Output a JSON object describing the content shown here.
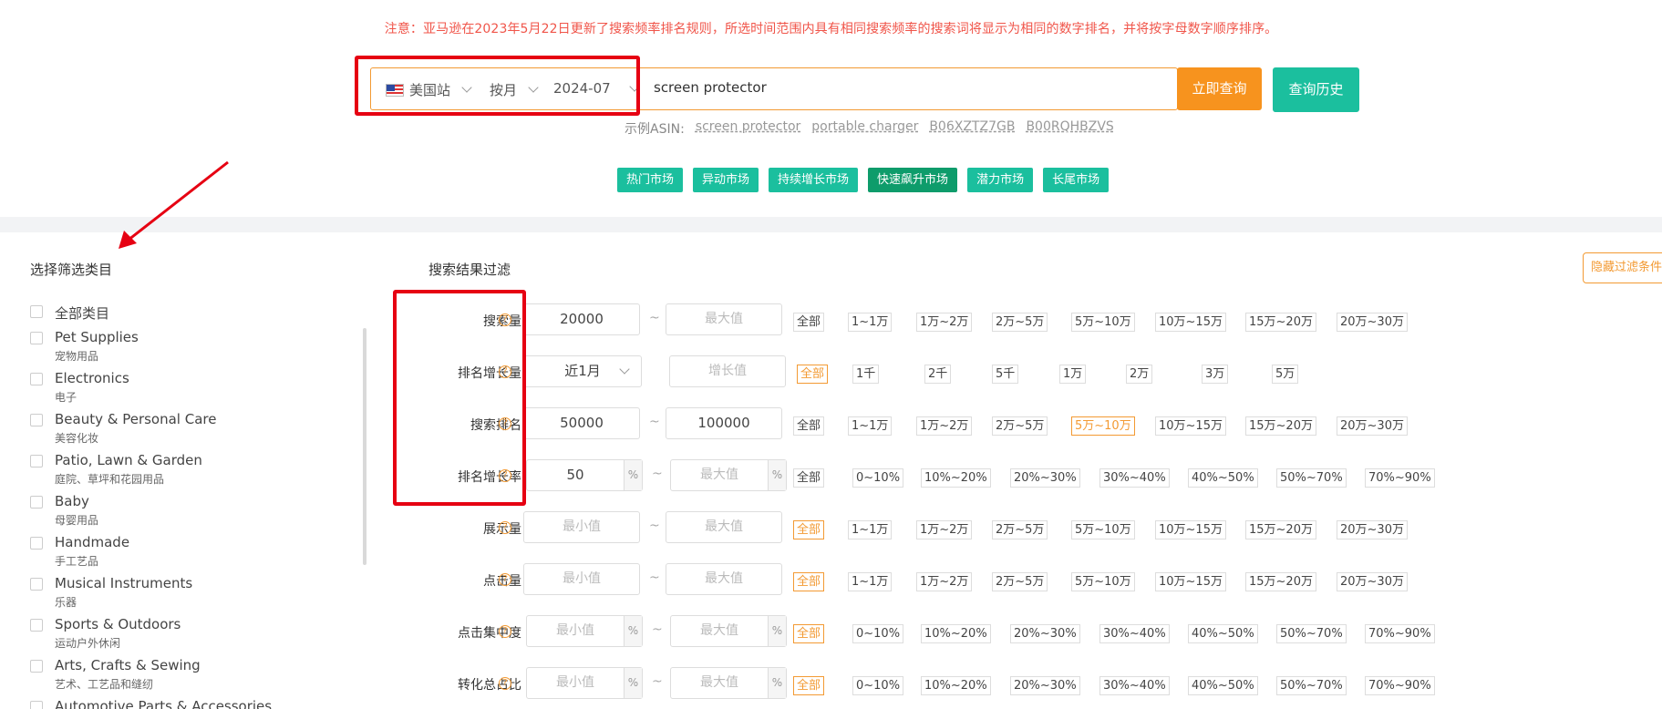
{
  "notice": "注意：亚马逊在2023年5月22日更新了搜索频率排名规则，所选时间范围内具有相同搜索频率的搜索词将显示为相同的数字排名，并将按字母数字顺序排序。",
  "search": {
    "site": "美国站",
    "period": "按月",
    "month": "2024-07",
    "query": "screen protector",
    "query_button": "立即查询",
    "history_button": "查询历史"
  },
  "examples": {
    "label": "示例ASIN:",
    "items": [
      "screen protector",
      "portable charger",
      "B06XZTZ7GB",
      "B00RQHBZVS"
    ]
  },
  "market_tabs": [
    {
      "label": "热门市场",
      "active": false
    },
    {
      "label": "异动市场",
      "active": false
    },
    {
      "label": "持续增长市场",
      "active": false
    },
    {
      "label": "快速飙升市场",
      "active": true
    },
    {
      "label": "潜力市场",
      "active": false
    },
    {
      "label": "长尾市场",
      "active": false
    }
  ],
  "categories": {
    "title": "选择筛选类目",
    "all_label": "全部类目",
    "items": [
      {
        "en": "Pet Supplies",
        "zh": "宠物用品"
      },
      {
        "en": "Electronics",
        "zh": "电子"
      },
      {
        "en": "Beauty & Personal Care",
        "zh": "美容化妆"
      },
      {
        "en": "Patio, Lawn & Garden",
        "zh": "庭院、草坪和花园用品"
      },
      {
        "en": "Baby",
        "zh": "母婴用品"
      },
      {
        "en": "Handmade",
        "zh": "手工艺品"
      },
      {
        "en": "Musical Instruments",
        "zh": "乐器"
      },
      {
        "en": "Sports & Outdoors",
        "zh": "运动户外休闲"
      },
      {
        "en": "Arts, Crafts & Sewing",
        "zh": "艺术、工艺品和缝纫"
      },
      {
        "en": "Automotive Parts & Accessories",
        "zh": ""
      }
    ]
  },
  "filters": {
    "title": "搜索结果过滤",
    "hide_button": "隐藏过滤条件",
    "help_glyph": "?",
    "percent_suffix": "%",
    "range_sep": "~",
    "rows": [
      {
        "label": "搜索量",
        "kind": "range",
        "min": "20000",
        "max": "",
        "min_ph": "最小值",
        "max_ph": "最大值",
        "chips": [
          "全部",
          "1~1万",
          "1万~2万",
          "2万~5万",
          "5万~10万",
          "10万~15万",
          "15万~20万",
          "20万~30万"
        ],
        "active_chip": -1
      },
      {
        "label": "排名增长量",
        "kind": "growth",
        "dropdown": "近1月",
        "value_ph": "增长值",
        "chips": [
          "全部",
          "1千",
          "2千",
          "5千",
          "1万",
          "2万",
          "3万",
          "5万"
        ],
        "active_chip": 0
      },
      {
        "label": "搜索排名",
        "kind": "range",
        "min": "50000",
        "max": "100000",
        "min_ph": "最小值",
        "max_ph": "最大值",
        "chips": [
          "全部",
          "1~1万",
          "1万~2万",
          "2万~5万",
          "5万~10万",
          "10万~15万",
          "15万~20万",
          "20万~30万"
        ],
        "active_chip": 4
      },
      {
        "label": "排名增长率",
        "kind": "pct",
        "min": "50",
        "max": "",
        "min_ph": "最小值",
        "max_ph": "最大值",
        "chips": [
          "全部",
          "0~10%",
          "10%~20%",
          "20%~30%",
          "30%~40%",
          "40%~50%",
          "50%~70%",
          "70%~90%"
        ],
        "active_chip": -1
      },
      {
        "label": "展示量",
        "kind": "range",
        "min": "",
        "max": "",
        "min_ph": "最小值",
        "max_ph": "最大值",
        "chips": [
          "全部",
          "1~1万",
          "1万~2万",
          "2万~5万",
          "5万~10万",
          "10万~15万",
          "15万~20万",
          "20万~30万"
        ],
        "active_chip": 0
      },
      {
        "label": "点击量",
        "kind": "range",
        "min": "",
        "max": "",
        "min_ph": "最小值",
        "max_ph": "最大值",
        "chips": [
          "全部",
          "1~1万",
          "1万~2万",
          "2万~5万",
          "5万~10万",
          "10万~15万",
          "15万~20万",
          "20万~30万"
        ],
        "active_chip": 0
      },
      {
        "label": "点击集中度",
        "kind": "pct",
        "min": "",
        "max": "",
        "min_ph": "最小值",
        "max_ph": "最大值",
        "chips": [
          "全部",
          "0~10%",
          "10%~20%",
          "20%~30%",
          "30%~40%",
          "40%~50%",
          "50%~70%",
          "70%~90%"
        ],
        "active_chip": 0
      },
      {
        "label": "转化总占比",
        "kind": "pct",
        "min": "",
        "max": "",
        "min_ph": "最小值",
        "max_ph": "最大值",
        "chips": [
          "全部",
          "0~10%",
          "10%~20%",
          "20%~30%",
          "30%~40%",
          "40%~50%",
          "50%~70%",
          "70%~90%"
        ],
        "active_chip": 0
      }
    ]
  },
  "colors": {
    "accent_orange": "#f7931e",
    "accent_teal": "#1bbf9e",
    "annotation_red": "#e60012",
    "notice_red": "#f0554a"
  }
}
